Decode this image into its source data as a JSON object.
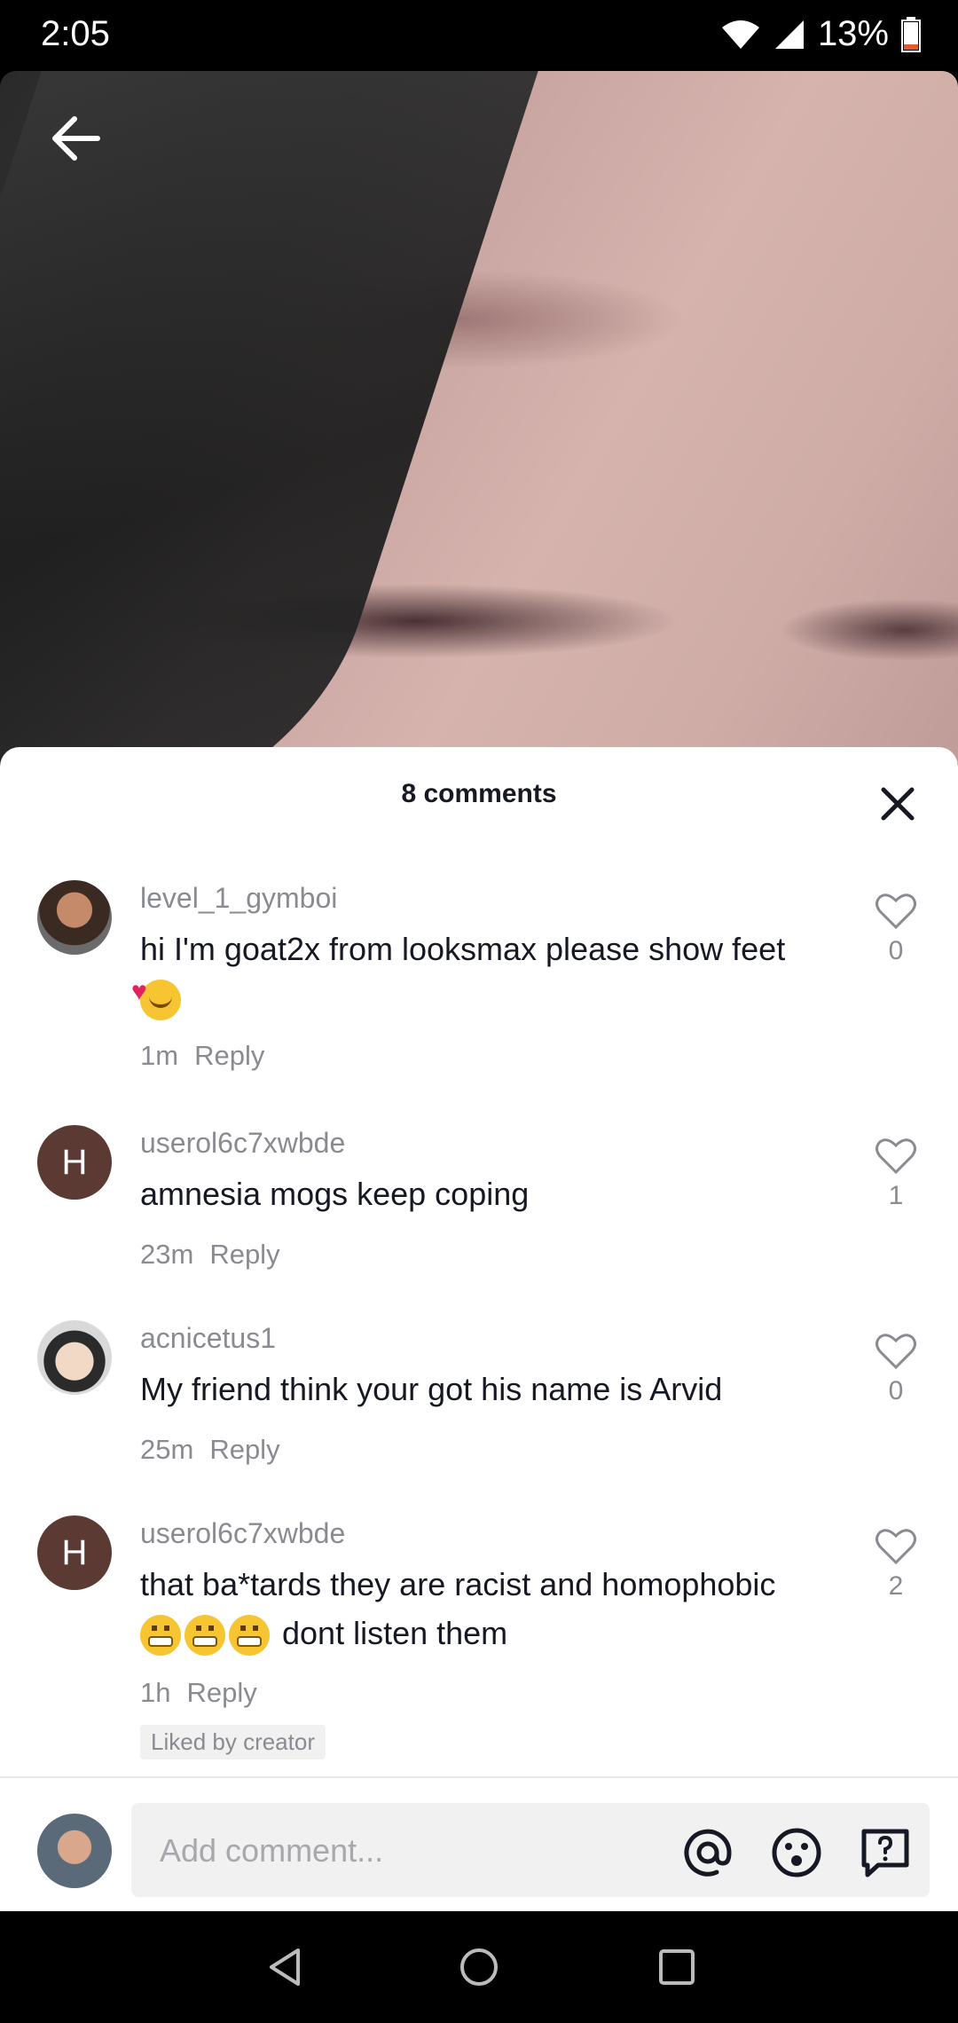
{
  "status_bar": {
    "time": "2:05",
    "battery": "13%"
  },
  "sheet": {
    "title": "8 comments"
  },
  "comments": [
    {
      "username": "level_1_gymboi",
      "text": "hi I'm goat2x from looksmax please show feet",
      "time": "1m",
      "reply": "Reply",
      "likes": "0",
      "avatar": "photo"
    },
    {
      "username": "userol6c7xwbde",
      "text": "amnesia mogs keep coping",
      "time": "23m",
      "reply": "Reply",
      "likes": "1",
      "avatar_letter": "H"
    },
    {
      "username": "acnicetus1",
      "text": "My friend think your got his name is Arvid",
      "time": "25m",
      "reply": "Reply",
      "likes": "0",
      "avatar": "anime"
    },
    {
      "username": "userol6c7xwbde",
      "text_end": "dont listen them",
      "text": "that ba*tards they are racist and homophobic",
      "time": "1h",
      "reply": "Reply",
      "likes": "2",
      "avatar_letter": "H",
      "badge": "Liked by creator"
    }
  ],
  "input": {
    "placeholder": "Add comment..."
  },
  "icons": [
    "back-arrow-icon",
    "close-icon",
    "heart-icon",
    "at-icon",
    "emoji-icon",
    "question-icon",
    "nav-back-icon",
    "nav-home-icon",
    "nav-recents-icon"
  ],
  "colors": {
    "text": "#161823",
    "muted": "#8a8b91",
    "sheet": "#ffffff",
    "input_bg": "#f1f1f2"
  }
}
